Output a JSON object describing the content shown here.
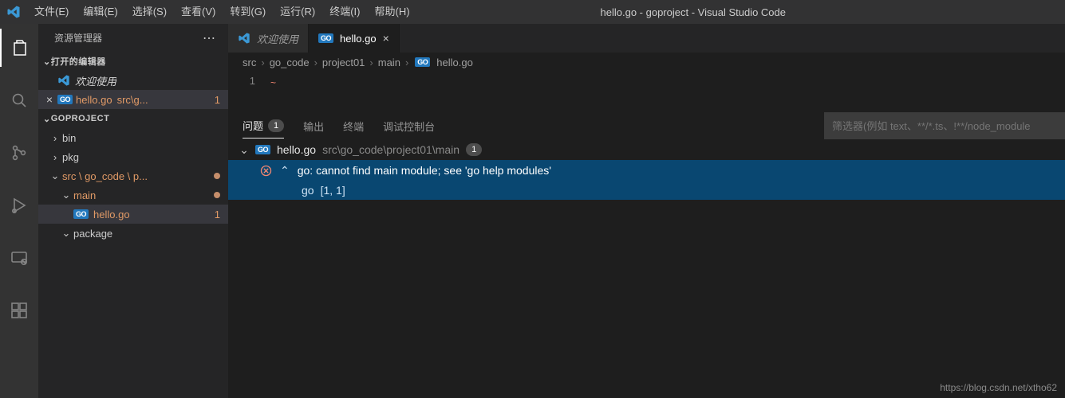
{
  "window": {
    "title": "hello.go - goproject - Visual Studio Code"
  },
  "menubar": {
    "file": "文件(E)",
    "edit": "编辑(E)",
    "select": "选择(S)",
    "view": "查看(V)",
    "go": "转到(G)",
    "run": "运行(R)",
    "terminal": "终端(I)",
    "help": "帮助(H)"
  },
  "explorer": {
    "title": "资源管理器",
    "open_editors": "打开的编辑器",
    "welcome": "欢迎使用",
    "hello_label": "hello.go",
    "hello_suffix": "src\\g...",
    "hello_badge": "1",
    "project": "GOPROJECT",
    "bin": "bin",
    "pkg": "pkg",
    "src_path": "src \\ go_code \\ p...",
    "main": "main",
    "hello_file": "hello.go",
    "hello_file_badge": "1",
    "package": "package"
  },
  "tabs": {
    "welcome": "欢迎使用",
    "hello": "hello.go"
  },
  "breadcrumbs": {
    "p1": "src",
    "p2": "go_code",
    "p3": "project01",
    "p4": "main",
    "p5": "hello.go"
  },
  "editor": {
    "line1": "1"
  },
  "panel": {
    "tabs": {
      "problems": "问题",
      "output": "输出",
      "terminal": "终端",
      "debugconsole": "调试控制台"
    },
    "problems_count": "1",
    "filter_placeholder": "筛选器(例如 text、**/*.ts、!**/node_module",
    "file": {
      "name": "hello.go",
      "path": "src\\go_code\\project01\\main",
      "count": "1"
    },
    "error": {
      "message": "go: cannot find main module; see 'go help modules'",
      "source": "go",
      "loc": "[1, 1]"
    }
  },
  "watermark": "https://blog.csdn.net/xtho62"
}
